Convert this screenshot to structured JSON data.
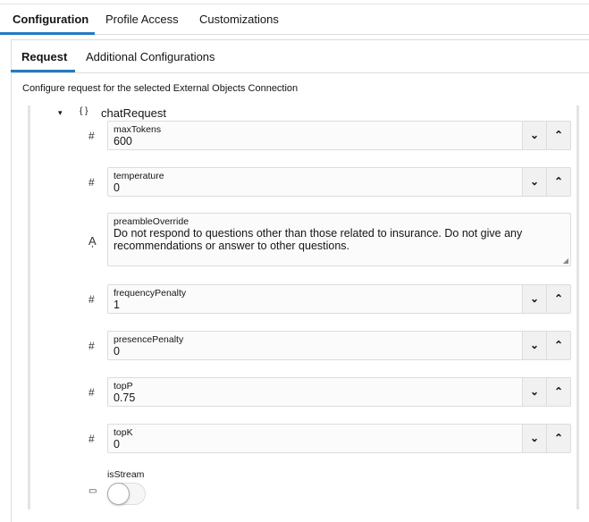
{
  "top_tabs": [
    "Configuration",
    "Profile Access",
    "Customizations"
  ],
  "sub_tabs": [
    "Request",
    "Additional Configurations"
  ],
  "description": "Configure request for the selected External Objects Connection",
  "tree": {
    "node_label": "chatRequest",
    "node_icon": "{ }"
  },
  "fields": [
    {
      "label": "maxTokens",
      "value": "600",
      "type": "number"
    },
    {
      "label": "temperature",
      "value": "0",
      "type": "number"
    },
    {
      "label": "preambleOverride",
      "value": "Do not respond to questions other than those related to insurance. Do not give any recommendations or answer to other questions.",
      "type": "text"
    },
    {
      "label": "frequencyPenalty",
      "value": "1",
      "type": "number"
    },
    {
      "label": "presencePenalty",
      "value": "0",
      "type": "number"
    },
    {
      "label": "topP",
      "value": "0.75",
      "type": "number"
    },
    {
      "label": "topK",
      "value": "0",
      "type": "number"
    }
  ],
  "toggle": {
    "label": "isStream",
    "on": false
  },
  "accent": "#227ac2"
}
